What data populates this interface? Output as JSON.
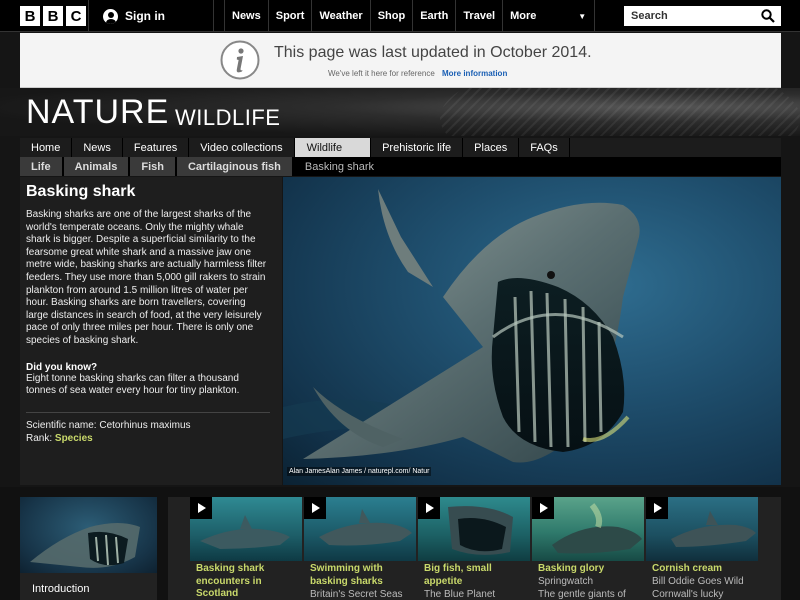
{
  "brand": {
    "letters": [
      "B",
      "B",
      "C"
    ]
  },
  "account": {
    "signin_label": "Sign in"
  },
  "nav": {
    "items": [
      "News",
      "Sport",
      "Weather",
      "Shop",
      "Earth",
      "Travel"
    ],
    "more_label": "More"
  },
  "search": {
    "placeholder": "Search"
  },
  "notice": {
    "message": "This page was last updated in October 2014.",
    "sub_text": "We've left it here for reference",
    "more_link": "More information"
  },
  "header": {
    "title": "NATURE",
    "subtitle": "WILDLIFE"
  },
  "section_nav": {
    "items": [
      "Home",
      "News",
      "Features",
      "Video collections",
      "Wildlife",
      "Prehistoric life",
      "Places",
      "FAQs"
    ],
    "active": "Wildlife"
  },
  "breadcrumb": {
    "items": [
      "Life",
      "Animals",
      "Fish",
      "Cartilaginous fish"
    ],
    "current": "Basking shark"
  },
  "article": {
    "title": "Basking shark",
    "description": "Basking sharks are one of the largest sharks of the world's temperate oceans. Only the mighty whale shark is bigger. Despite a superficial similarity to the fearsome great white shark and a massive jaw one metre wide, basking sharks are actually harmless filter feeders. They use more than 5,000 gill rakers to strain plankton from around 1.5 million litres of water per hour. Basking sharks are born travellers, covering large distances in search of food, at the very leisurely pace of only three miles per hour. There is only one species of basking shark.",
    "did_you_know_title": "Did you know?",
    "did_you_know_text": "Eight tonne basking sharks can filter a thousand tonnes of sea water every hour for tiny plankton.",
    "scientific_name": "Scientific name: Cetorhinus maximus",
    "rank_label": "Rank:",
    "rank_value": "Species"
  },
  "hero": {
    "credit": "Alan JamesAlan James / naturepl.com/ Natur"
  },
  "intro": {
    "label": "Introduction"
  },
  "clips": [
    {
      "title": "Basking shark encounters in Scotland",
      "source": ""
    },
    {
      "title": "Swimming with basking sharks",
      "source": "Britain's Secret Seas"
    },
    {
      "title": "Big fish, small appetite",
      "source": "The Blue Planet"
    },
    {
      "title": "Basking glory",
      "source": "Springwatch",
      "source2": "The gentle giants of"
    },
    {
      "title": "Cornish cream",
      "source": "Bill Oddie Goes Wild",
      "source2": "Cornwall's lucky"
    }
  ],
  "colors": {
    "accent_green": "#c9d96b",
    "link_blue": "#1a5fb4"
  }
}
